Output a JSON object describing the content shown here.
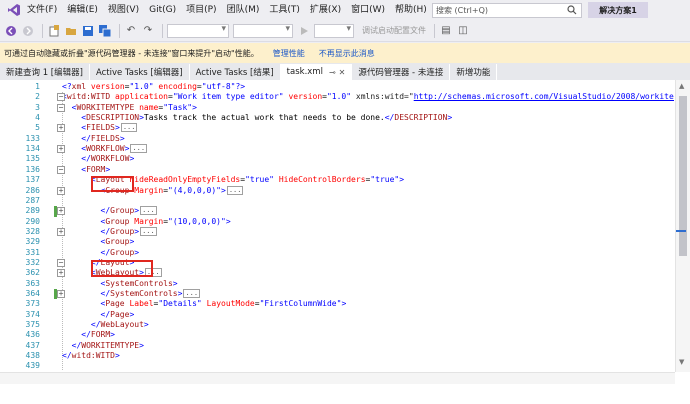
{
  "menu": [
    "文件(F)",
    "编辑(E)",
    "视图(V)",
    "Git(G)",
    "项目(P)",
    "团队(M)",
    "工具(T)",
    "扩展(X)",
    "窗口(W)",
    "帮助(H)"
  ],
  "search_placeholder": "搜索 (Ctrl+Q)",
  "solution_name": "解决方案1",
  "toolbar": {
    "debug_attach": "调试启动配置文件"
  },
  "infobar": {
    "message": "可通过自动隐藏或折叠\"源代码管理器 - 未连接\"窗口来提升\"启动\"性能。",
    "link1": "管理性能",
    "link2": "不再显示此消息"
  },
  "tabs": [
    "新建查询 1 [编辑器]",
    "Active Tasks [编辑器]",
    "Active Tasks [结果]",
    "task.xml",
    "源代码管理器 - 未连接",
    "新增功能"
  ],
  "active_tab_index": 3,
  "line_numbers": [
    "1",
    "2",
    "3",
    "4",
    "5",
    "133",
    "134",
    "135",
    "136",
    "137",
    "286",
    "287",
    "289",
    "290",
    "328",
    "329",
    "331",
    "332",
    "362",
    "363",
    "364",
    "373",
    "374",
    "375",
    "436",
    "437",
    "438",
    "439"
  ],
  "code_lines": [
    "<?xml version=\"1.0\" encoding=\"utf-8\"?>",
    "<witd:WITD application=\"Work item type editor\" version=\"1.0\" xmlns:witd=\"http://schemas.microsoft.com/VisualStudio/2008/workitem",
    "  <WORKITEMTYPE name=\"Task\">",
    "    <DESCRIPTION>Tasks track the actual work that needs to be done.</DESCRIPTION>",
    "    <FIELDS>",
    "    </FIELDS>",
    "    <WORKFLOW>",
    "    </WORKFLOW>",
    "    <FORM>",
    "      <Layout HideReadOnlyEmptyFields=\"true\" HideControlBorders=\"true\">",
    "        <Group Margin=\"(4,0,0,0)\">",
    "        </Group>",
    "        <Group Margin=\"(10,0,0,0)\">",
    "        </Group>",
    "        <Group>",
    "        </Group>",
    "      </Layout>",
    "      <WebLayout>",
    "        <SystemControls>",
    "        </SystemControls>",
    "        <Page Label=\"Details\" LayoutMode=\"FirstColumnWide\">",
    "        </Page>",
    "      </WebLayout>",
    "    </FORM>",
    "  </WORKITEMTYPE>",
    "</witd:WITD>"
  ],
  "collapsed_marker": "...",
  "colors": {
    "accent": "#2d6dd0",
    "highlight": "#e0271f",
    "tag": "#a31515",
    "attr": "#ff0000",
    "value": "#0000ff"
  }
}
